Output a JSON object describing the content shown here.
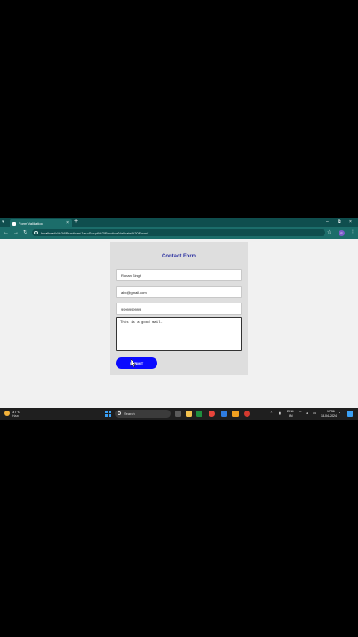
{
  "browser": {
    "tab_title": "Form Validation",
    "tab_close": "×",
    "new_tab": "+",
    "window_minimize": "–",
    "window_restore": "⧉",
    "window_close": "×",
    "url_host": "localhost",
    "url_path": "/d%3A/Practices/JavaScript%20Practice/Validate%20Form/",
    "profile_initial": "S"
  },
  "form": {
    "title": "Contact Form",
    "name_value": "Rohan Singh",
    "email_value": "abc@gmail.com",
    "phone_value": "9999999999",
    "message_value": "This is a good mail.",
    "submit_label": "SUBMIT"
  },
  "taskbar": {
    "weather_temp": "37°C",
    "weather_desc": "Haze",
    "search_placeholder": "Search",
    "lang_top": "ENG",
    "lang_bottom": "IN",
    "time": "17:36",
    "date": "18-04-2024"
  },
  "colors": {
    "submit_bg": "#0a0aff",
    "title_color": "#2a2fa0",
    "browser_frame": "#1c6d6a"
  }
}
